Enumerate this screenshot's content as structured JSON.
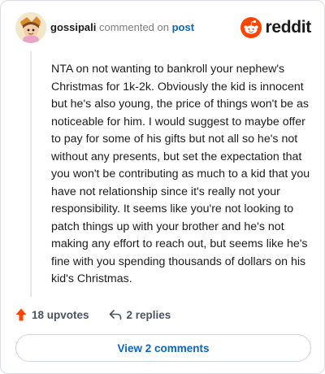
{
  "comment": {
    "username": "gossipali",
    "action_text": "commented on",
    "post_link": "post",
    "body": "NTA on not wanting to bankroll your nephew's Christmas for 1k-2k. Obviously the kid is innocent but he's also young, the price of things won't be as noticeable for him. I would suggest to maybe offer to pay for some of his gifts but not all so he's not without any presents, but set the expectation that you won't be contributing as much to a kid that you have not relationship since it's really not your responsibility. It seems like you're not looking to patch things up with your brother and he's not making any effort to reach out, but seems like he's fine with you spending thousands of dollars on his kid's Christmas."
  },
  "brand": {
    "name": "reddit",
    "color": "#ff4500"
  },
  "actions": {
    "upvotes": "18 upvotes",
    "replies": "2 replies"
  },
  "view_comments": "View 2 comments",
  "icons": {
    "avatar": "avatar-icon",
    "reddit_logo": "reddit-logo-icon",
    "upvote": "upvote-arrow-icon",
    "reply": "reply-arrow-icon"
  },
  "colors": {
    "link": "#0a66c2",
    "upvote": "#ff4500",
    "muted_text": "#7c7c7c"
  }
}
